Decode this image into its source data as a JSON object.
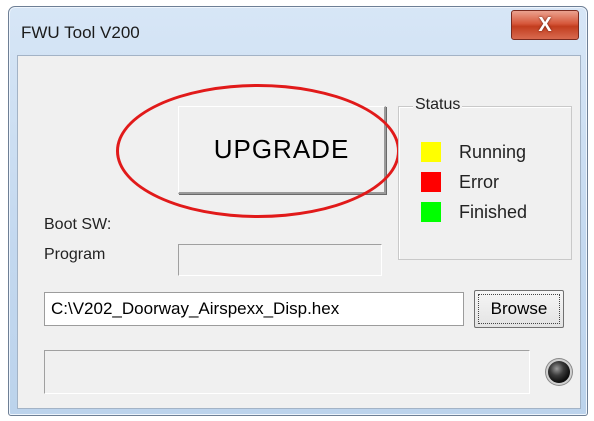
{
  "window": {
    "title": "FWU Tool V200",
    "close_label": "X"
  },
  "upgrade": {
    "label": "UPGRADE",
    "annotation_color": "#e11a1a"
  },
  "labels": {
    "boot_sw": "Boot SW:",
    "program": "Program"
  },
  "status": {
    "title": "Status",
    "items": [
      {
        "label": "Running",
        "color": "#ffff00"
      },
      {
        "label": "Error",
        "color": "#ff0000"
      },
      {
        "label": "Finished",
        "color": "#00ff00"
      }
    ]
  },
  "file": {
    "path": "C:\\V202_Doorway_Airspexx_Disp.hex",
    "browse_label": "Browse"
  },
  "progress": {
    "value": 0
  },
  "icons": {
    "close": "close-icon",
    "led": "status-led-icon"
  }
}
